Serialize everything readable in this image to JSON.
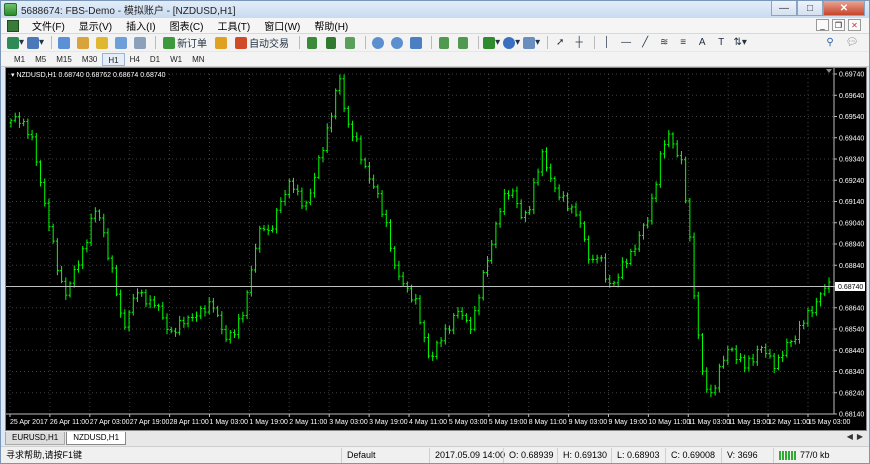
{
  "window": {
    "title": "5688674: FBS-Demo - 模拟账户 - [NZDUSD,H1]"
  },
  "menu": {
    "items": [
      "文件(F)",
      "显示(V)",
      "插入(I)",
      "图表(C)",
      "工具(T)",
      "窗口(W)",
      "帮助(H)"
    ]
  },
  "toolbar": {
    "new_order": "新订单",
    "auto_trading": "自动交易",
    "indicator_letter": "A",
    "text_letter": "T"
  },
  "timeframes": [
    "M1",
    "M5",
    "M15",
    "M30",
    "H1",
    "H4",
    "D1",
    "W1",
    "MN"
  ],
  "active_timeframe": "H1",
  "chart": {
    "header": "NZDUSD,H1  0.68740 0.68762 0.68674 0.68740",
    "price_axis": [
      "0.69740",
      "0.69640",
      "0.69540",
      "0.69440",
      "0.69340",
      "0.69240",
      "0.69140",
      "0.69040",
      "0.68940",
      "0.68840",
      "0.68740",
      "0.68640",
      "0.68540",
      "0.68440",
      "0.68340",
      "0.68240",
      "0.68140"
    ],
    "current_price": "0.68740",
    "time_axis": [
      "25 Apr 2017",
      "26 Apr 11:00",
      "27 Apr 03:00",
      "27 Apr 19:00",
      "28 Apr 11:00",
      "1 May 03:00",
      "1 May 19:00",
      "2 May 11:00",
      "3 May 03:00",
      "3 May 19:00",
      "4 May 11:00",
      "5 May 03:00",
      "5 May 19:00",
      "8 May 11:00",
      "9 May 03:00",
      "9 May 19:00",
      "10 May 11:00",
      "11 May 03:00",
      "11 May 19:00",
      "12 May 11:00",
      "15 May 03:00"
    ],
    "colors": {
      "background": "#000000",
      "bars": "#00ff00",
      "grid": "#404040",
      "price_line": "#c0c0c0"
    },
    "close_path": [
      0.6951,
      0.6954,
      0.695,
      0.6942,
      0.6928,
      0.691,
      0.6893,
      0.6878,
      0.687,
      0.688,
      0.6889,
      0.6898,
      0.691,
      0.6905,
      0.6886,
      0.6873,
      0.6855,
      0.6862,
      0.6872,
      0.687,
      0.6865,
      0.6865,
      0.6858,
      0.685,
      0.6856,
      0.686,
      0.6858,
      0.6862,
      0.6866,
      0.6864,
      0.6855,
      0.685,
      0.6852,
      0.686,
      0.6875,
      0.6892,
      0.6905,
      0.6898,
      0.6908,
      0.6918,
      0.6924,
      0.6916,
      0.6912,
      0.692,
      0.6932,
      0.6945,
      0.6958,
      0.6972,
      0.6952,
      0.6945,
      0.6935,
      0.6928,
      0.692,
      0.691,
      0.69,
      0.688,
      0.6876,
      0.6872,
      0.6865,
      0.685,
      0.684,
      0.6846,
      0.6852,
      0.6858,
      0.6862,
      0.6858,
      0.6856,
      0.687,
      0.6886,
      0.6898,
      0.691,
      0.692,
      0.6918,
      0.6905,
      0.691,
      0.6925,
      0.6935,
      0.6928,
      0.6918,
      0.6914,
      0.6912,
      0.6908,
      0.6895,
      0.6885,
      0.689,
      0.6878,
      0.6875,
      0.688,
      0.6886,
      0.6892,
      0.6898,
      0.6905,
      0.692,
      0.6936,
      0.6946,
      0.694,
      0.693,
      0.69,
      0.686,
      0.683,
      0.6822,
      0.6832,
      0.684,
      0.6846,
      0.684,
      0.6836,
      0.684,
      0.6846,
      0.6842,
      0.6838,
      0.684,
      0.6846,
      0.685,
      0.6856,
      0.686,
      0.6866,
      0.6872,
      0.6874
    ]
  },
  "tabs": [
    "EURUSD,H1",
    "NZDUSD,H1"
  ],
  "active_tab": "NZDUSD,H1",
  "status": {
    "help": "寻求帮助,请按F1键",
    "profile": "Default",
    "datetime": "2017.05.09 14:00",
    "open": "O: 0.68939",
    "high": "H: 0.69130",
    "low": "L: 0.68903",
    "close": "C: 0.69008",
    "volume": "V: 3696",
    "traffic": "77/0 kb"
  }
}
